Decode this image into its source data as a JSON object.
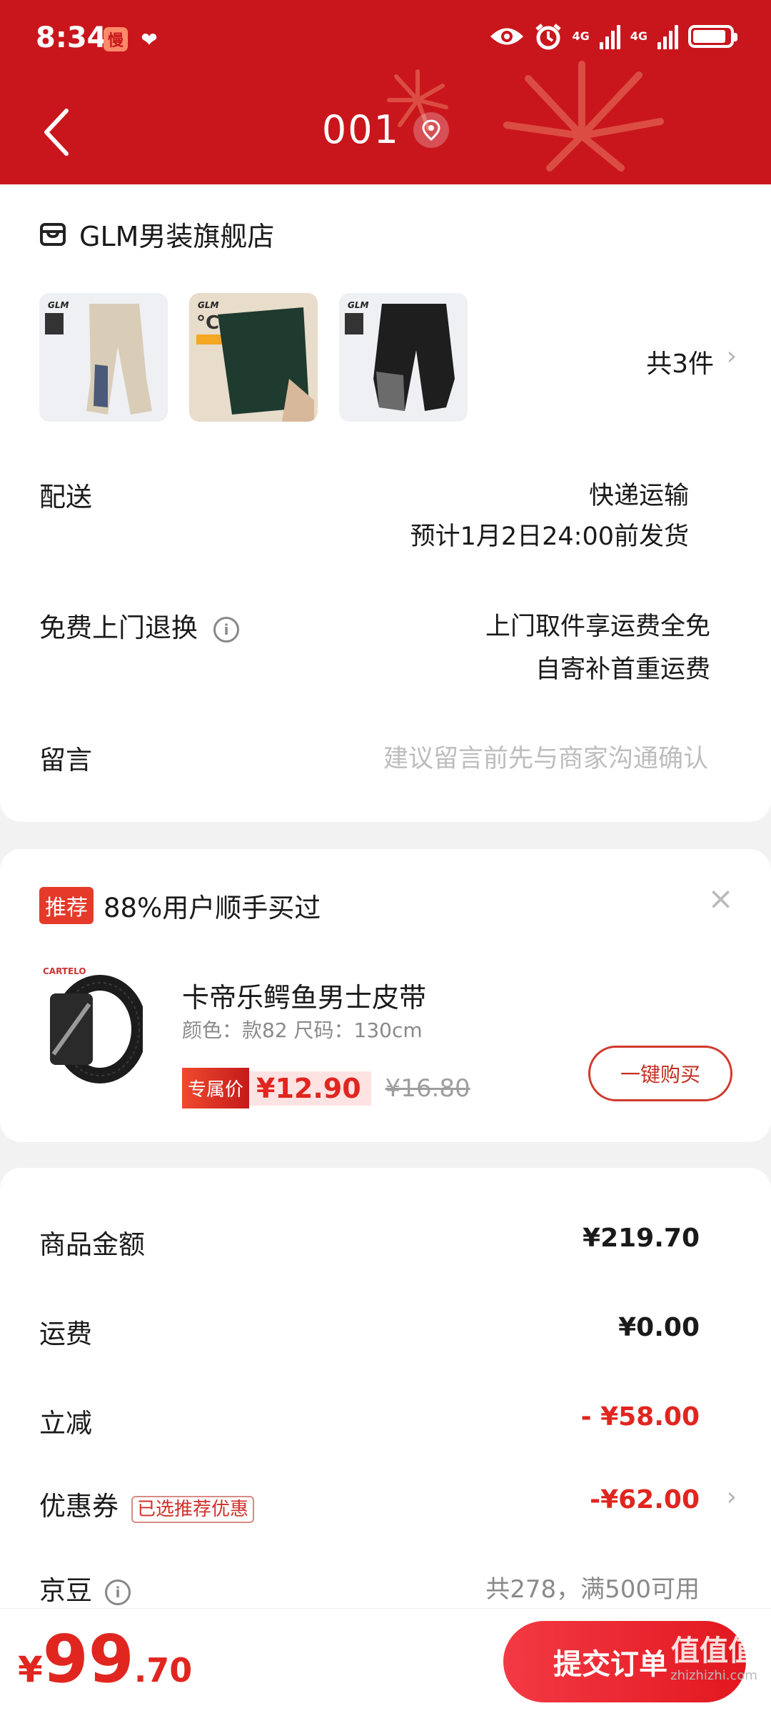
{
  "status_bar": {
    "time": "8:34",
    "badge1": "慢",
    "badge2": "❤",
    "net1": "4G",
    "net2": "4G"
  },
  "header": {
    "title": "001"
  },
  "order": {
    "shop_name": "GLM男装旗舰店",
    "thumb_brand": "GLM",
    "item_count": "共3件",
    "delivery_label": "配送",
    "delivery_method": "快递运输",
    "delivery_eta": "预计1月2日24:00前发货",
    "return_label": "免费上门退换",
    "return_line1": "上门取件享运费全免",
    "return_line2": "自寄补首重运费",
    "message_label": "留言",
    "message_placeholder": "建议留言前先与商家沟通确认"
  },
  "recommend": {
    "tag": "推荐",
    "title": "88%用户顺手买过",
    "product_name": "卡帝乐鳄鱼男士皮带",
    "product_spec": "颜色：款82   尺码：130cm",
    "exclusive_label": "专属价",
    "price": "¥12.90",
    "old_price": "¥16.80",
    "buy_label": "一键购买",
    "brand_mark": "CARTELO"
  },
  "summary": {
    "goods_label": "商品金额",
    "goods_value": "¥219.70",
    "shipping_label": "运费",
    "shipping_value": "¥0.00",
    "discount_label": "立减",
    "discount_value": "- ¥58.00",
    "coupon_label": "优惠券",
    "coupon_tag": "已选推荐优惠",
    "coupon_value": "-¥62.00",
    "beans_label": "京豆",
    "beans_value": "共278，满500可用"
  },
  "footer": {
    "currency": "¥",
    "total_int": "99",
    "total_dec": ".70",
    "submit_label": "提交订单",
    "watermark": "值值值",
    "watermark_site": "zhizhizhi.com"
  },
  "colors": {
    "header_red": "#c9161c",
    "price_red": "#e0261f",
    "accent": "#d13a2c"
  }
}
